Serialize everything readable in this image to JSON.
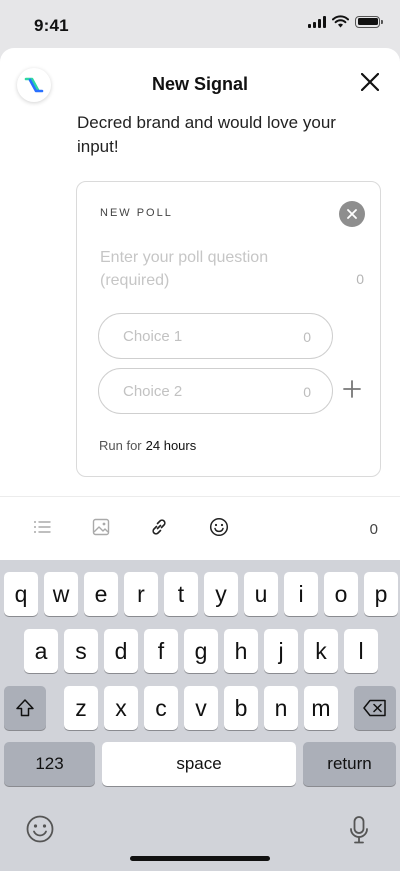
{
  "status_bar": {
    "time": "9:41"
  },
  "header": {
    "title": "New Signal"
  },
  "body_text": "Decred brand and would love your input!",
  "poll": {
    "label": "NEW POLL",
    "question_placeholder": "Enter your poll question (required)",
    "question_count": "0",
    "choices": [
      {
        "placeholder": "Choice 1",
        "count": "0"
      },
      {
        "placeholder": "Choice 2",
        "count": "0"
      }
    ],
    "run_for_label": "Run for",
    "run_for_value": "24 hours"
  },
  "toolbar": {
    "char_count": "0"
  },
  "keyboard": {
    "row1": [
      "q",
      "w",
      "e",
      "r",
      "t",
      "y",
      "u",
      "i",
      "o",
      "p"
    ],
    "row2": [
      "a",
      "s",
      "d",
      "f",
      "g",
      "h",
      "j",
      "k",
      "l"
    ],
    "row3": [
      "z",
      "x",
      "c",
      "v",
      "b",
      "n",
      "m"
    ],
    "numbers_label": "123",
    "space_label": "space",
    "return_label": "return"
  },
  "colors": {
    "sheet_bg": "#ffffff",
    "keyboard_bg": "#d1d3d9",
    "logo_blue": "#2970ff",
    "logo_teal": "#2ed8a3"
  }
}
